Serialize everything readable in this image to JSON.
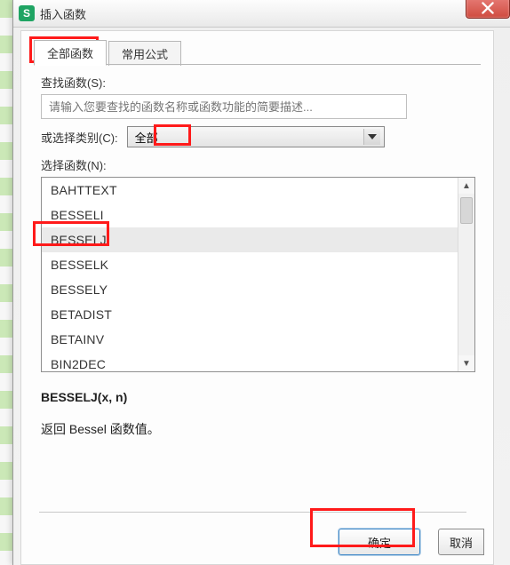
{
  "titlebar": {
    "app_icon_letter": "S",
    "title": "插入函数"
  },
  "tabs": {
    "all_label": "全部函数",
    "common_label": "常用公式"
  },
  "search": {
    "label": "查找函数(S):",
    "placeholder": "请输入您要查找的函数名称或函数功能的简要描述..."
  },
  "category": {
    "label": "或选择类别(C):",
    "selected": "全部"
  },
  "function_list": {
    "label": "选择函数(N):",
    "items": [
      "BAHTTEXT",
      "BESSELI",
      "BESSELJ",
      "BESSELK",
      "BESSELY",
      "BETADIST",
      "BETAINV",
      "BIN2DEC"
    ],
    "selected_index": 2
  },
  "description": {
    "signature": "BESSELJ(x, n)",
    "explain": "返回 Bessel 函数值。"
  },
  "buttons": {
    "ok": "确定",
    "cancel": "取消"
  }
}
